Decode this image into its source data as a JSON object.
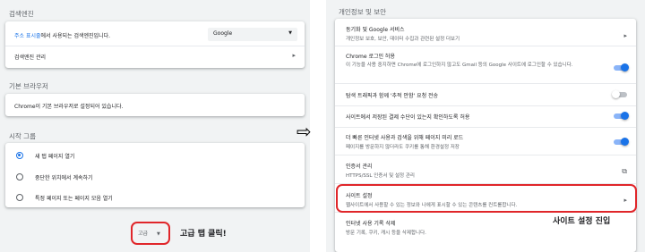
{
  "left": {
    "search_engine": {
      "title": "검색엔진",
      "address_bar_link": "주소 표시줄",
      "address_bar_rest": "에서 사용되는 검색엔진입니다.",
      "engine_value": "Google",
      "manage_label": "검색엔진 관리"
    },
    "default_browser": {
      "title": "기본 브라우저",
      "status": "Chrome이 기본 브라우저로 설정되어 있습니다."
    },
    "startup": {
      "title": "시작 그룹",
      "options": [
        "새 탭 페이지 열기",
        "중단한 위치에서 계속하기",
        "특정 페이지 또는 페이지 모음 열기"
      ],
      "selected_index": 0
    },
    "advanced_button": "고급",
    "annotation": "고급 탭 클릭!"
  },
  "arrow": "⇨",
  "right": {
    "title": "개인정보 및 보안",
    "items": [
      {
        "label": "동기화 및 Google 서비스",
        "sub": "개인정보 보호, 보안, 데이터 수집과 관련된 설정 더보기"
      },
      {
        "label": "Chrome 로그인 허용",
        "sub": "이 기능을 사용 중지하면 Chrome에 로그인하지 않고도 Gmail 등의 Google 사이트에 로그인할 수 있습니다."
      },
      {
        "label": "탐색 트래픽과 함께 '추적 안함' 요청 전송",
        "sub": ""
      },
      {
        "label": "사이트에서 저장된 결제 수단이 있는지 확인하도록 허용",
        "sub": ""
      },
      {
        "label": "더 빠른 인터넷 사용과 검색을 위해 페이지 미리 로드",
        "sub": "페이지를 방문하지 않더라도 쿠키를 통해 환경설정 저장"
      },
      {
        "label": "인증서 관리",
        "sub": "HTTPS/SSL 인증서 및 설정 관리"
      },
      {
        "label": "사이트 설정",
        "sub": "웹사이트에서 사용할 수 있는 정보와 나에게 표시할 수 있는 콘텐츠를 컨트롤합니다."
      },
      {
        "label": "인터넷 사용 기록 삭제",
        "sub": "방문 기록, 쿠키, 캐시 등을 삭제합니다."
      }
    ],
    "toggles": {
      "allow_login": true,
      "do_not_track": false,
      "payment_check": true,
      "preload": true
    },
    "annotation": "사이트 설정 진입"
  },
  "colors": {
    "accent": "#1a73e8",
    "highlight": "#e0262a",
    "panel_bg": "#f1f3f4"
  }
}
